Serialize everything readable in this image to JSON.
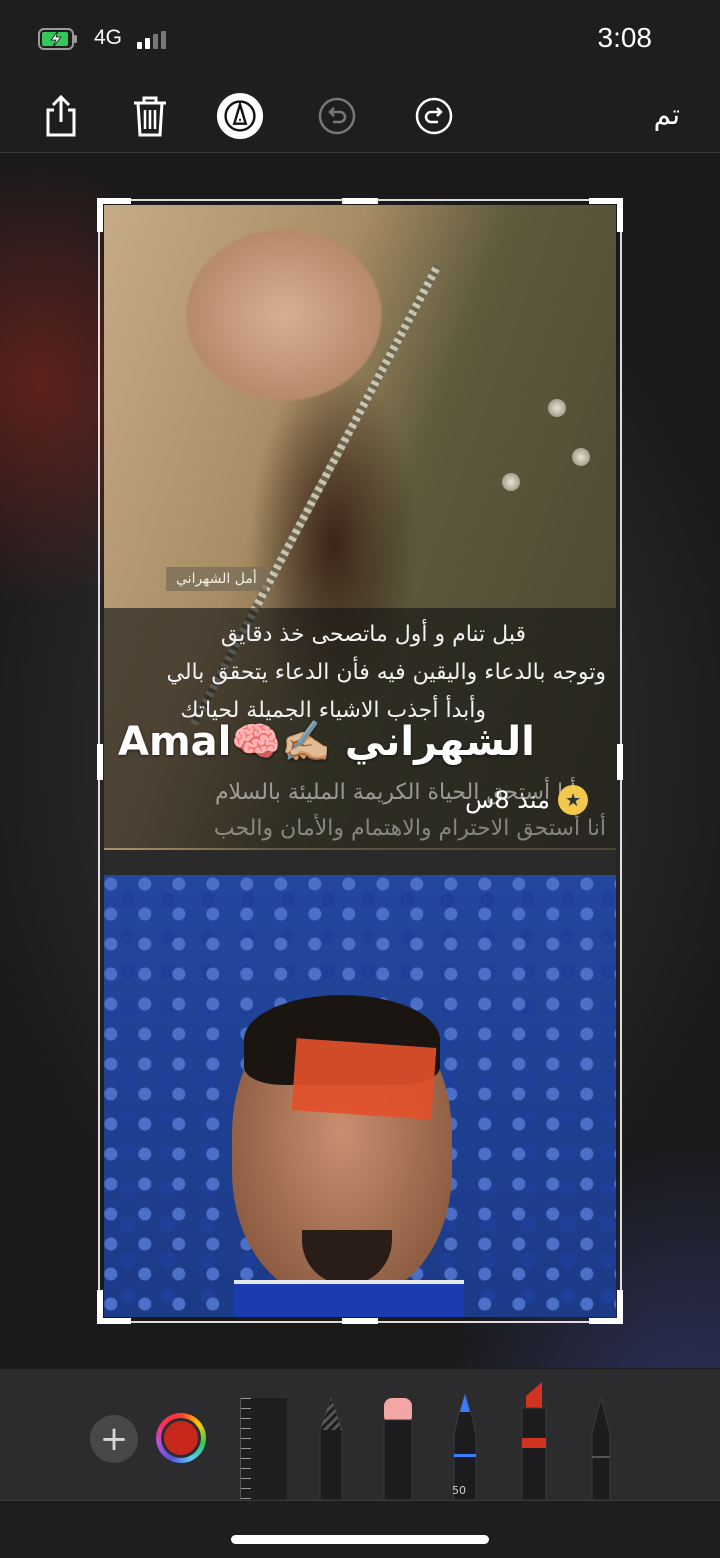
{
  "status_bar": {
    "network": "4G",
    "time": "3:08"
  },
  "toolbar": {
    "done_label": "تم"
  },
  "screenshot": {
    "watermark": "أمل الشهراني",
    "caption_lines": [
      "قبل تنام و أول ماتصحى خذ دقايق",
      "وتوجه بالدعاء واليقين فيه فأن الدعاء يتحقق بالي",
      "وأبدأ أجذب الاشياء الجميلة لحياتك",
      "أنا أستحق الحياة الكريمة المليئة بالسلام",
      "أنا أستحق الاحترام والاهتمام والأمان والحب"
    ],
    "name_latin": "Amal",
    "name_emoji": "🧠✍🏼",
    "name_arabic": "الشهراني",
    "time_ago": "منذ 8س"
  },
  "palette": {
    "pen_width": "50"
  },
  "icons": [
    "share-icon",
    "trash-icon",
    "markup-icon",
    "undo-icon",
    "redo-icon",
    "plus-icon",
    "star-icon"
  ],
  "colors": {
    "selected_color": "#c8281c",
    "accent": "#ffffff"
  }
}
